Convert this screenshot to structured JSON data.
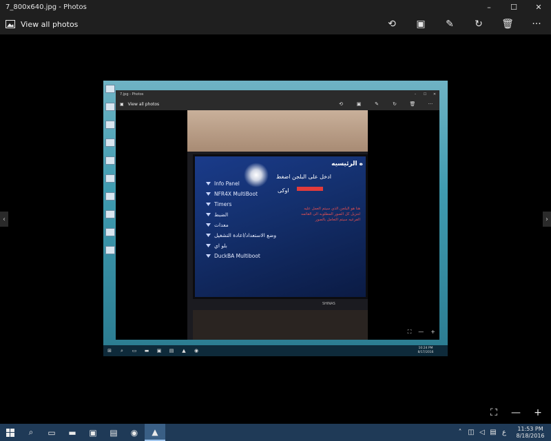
{
  "window": {
    "title": "7_800x640.jpg - Photos",
    "controls": {
      "minimize": "–",
      "maximize": "☐",
      "close": "✕"
    }
  },
  "appbar": {
    "view_all_label": "View all photos",
    "tools": [
      {
        "name": "share-icon",
        "glyph": "⟲"
      },
      {
        "name": "slideshow-icon",
        "glyph": "▣"
      },
      {
        "name": "edit-icon",
        "glyph": "✎"
      },
      {
        "name": "rotate-icon",
        "glyph": "↻"
      },
      {
        "name": "delete-icon",
        "glyph": "🗑"
      },
      {
        "name": "more-icon",
        "glyph": "···"
      }
    ]
  },
  "photo": {
    "inner_window_title": "7.jpg - Photos",
    "inner_view_all_label": "View all photos",
    "screen_header": "ه الرئيسيه",
    "menu_items": [
      "Info Panel",
      "NFR4X MultiBoot",
      "Timers",
      "الضبط",
      "معدات",
      "وضع الاستعداد/اعادة التشغيل",
      "بلو اي",
      "DuckBA Multiboot"
    ],
    "arabic_instruction": "ادخل على البلجن اضغط",
    "arabic_ok": "اوكى",
    "red_note": "هنا هو البلجن الذي سيتم العمل عليه لتنزيل كل الصور المطلوبه الى القائمه الفرعيه سيتم التعامل بالصور",
    "tv_brand": "SHINAS",
    "inner_clock_time": "10:24 PM",
    "inner_clock_date": "8/17/2016"
  },
  "bottom_controls": {
    "fit_icon": "⛶",
    "zoom_out": "—",
    "zoom_in": "+"
  },
  "taskbar": {
    "clock_time": "11:53 PM",
    "clock_date": "8/18/2016",
    "lang": "ع"
  },
  "colors": {
    "chrome": "#1f1f1f",
    "taskbar": "#1f3a57",
    "accent": "#9fc5ee"
  }
}
